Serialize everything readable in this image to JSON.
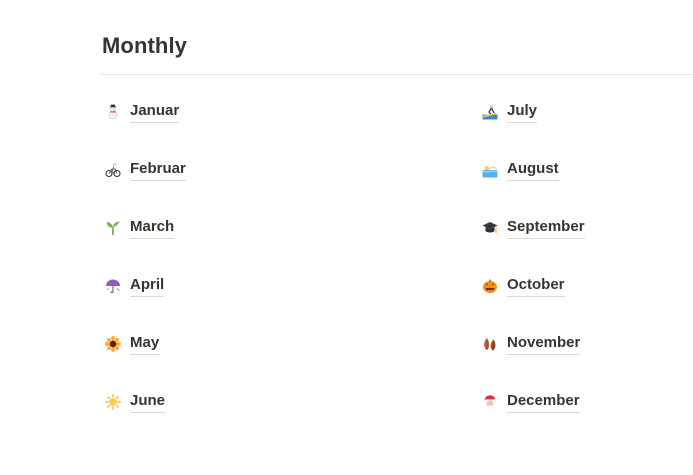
{
  "page": {
    "title": "Monthly"
  },
  "months_left": [
    {
      "label": "Januar",
      "icon": "snowman-icon"
    },
    {
      "label": "Februar",
      "icon": "cyclist-icon"
    },
    {
      "label": "March",
      "icon": "seedling-icon"
    },
    {
      "label": "April",
      "icon": "umbrella-rain-icon"
    },
    {
      "label": "May",
      "icon": "sunflower-icon"
    },
    {
      "label": "June",
      "icon": "sun-icon"
    }
  ],
  "months_right": [
    {
      "label": "July",
      "icon": "surfer-icon"
    },
    {
      "label": "August",
      "icon": "swimmer-icon"
    },
    {
      "label": "September",
      "icon": "graduation-cap-icon"
    },
    {
      "label": "October",
      "icon": "jack-o-lantern-icon"
    },
    {
      "label": "November",
      "icon": "fallen-leaves-icon"
    },
    {
      "label": "December",
      "icon": "santa-icon"
    }
  ]
}
